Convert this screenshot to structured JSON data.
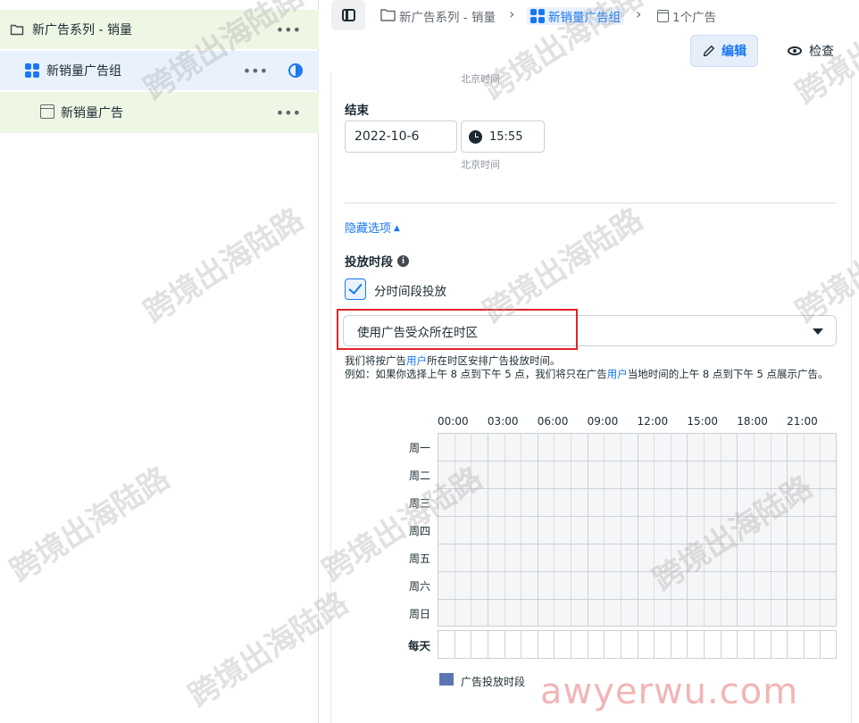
{
  "tree": {
    "campaign": {
      "label": "新广告系列 - 销量",
      "more": "•••"
    },
    "adset": {
      "label": "新销量广告组",
      "more": "•••"
    },
    "ad": {
      "label": "新销量广告",
      "more": "•••"
    }
  },
  "breadcrumb": {
    "campaign": "新广告系列 - 销量",
    "adset": "新销量广告组",
    "ad": "1个广告",
    "separator": "›"
  },
  "toolbar": {
    "edit_label": "编辑",
    "view_label": "检查"
  },
  "schedule_form": {
    "tz_top": "北京时间",
    "end_label": "结束",
    "end_date": "2022-10-6",
    "end_time": "15:55",
    "tz_bottom": "北京时间",
    "hide_options": "隐藏选项",
    "dayparting_title": "投放时段",
    "dayparting_checkbox": "分时间段投放",
    "timezone_select": "使用广告受众所在时区",
    "help_line1_a": "我们将按广告",
    "help_line1_link": "用户",
    "help_line1_b": "所在时区安排广告投放时间。",
    "help_line2_a": "例如：如果你选择上午 8 点到下午 5 点，我们将只在广告",
    "help_line2_link": "用户",
    "help_line2_b": "当地时间的上午 8 点到下午 5 点展示广告。"
  },
  "schedule_grid": {
    "hours": [
      "00:00",
      "03:00",
      "06:00",
      "09:00",
      "12:00",
      "15:00",
      "18:00",
      "21:00"
    ],
    "days": [
      "周一",
      "周二",
      "周三",
      "周四",
      "周五",
      "周六",
      "周日"
    ],
    "daily_label": "每天",
    "legend_label": "广告投放时段",
    "legend_color": "#5b75b5",
    "selected_slots": []
  },
  "watermark": {
    "text": "跨境出海陆路",
    "brand": "awyerwu.com"
  }
}
